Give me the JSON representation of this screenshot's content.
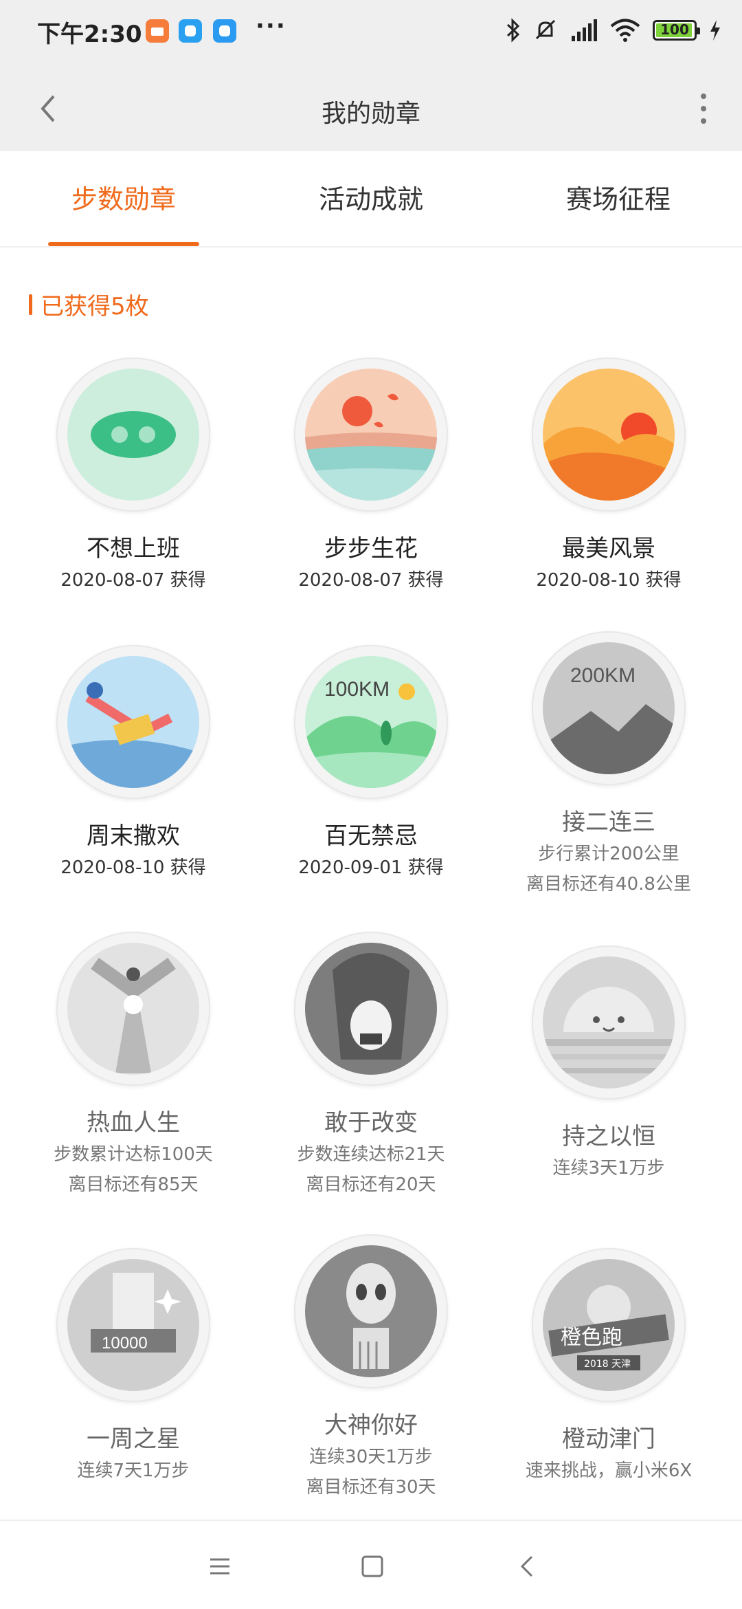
{
  "status_bar": {
    "time": "下午2:30",
    "dots": "···",
    "battery": "100",
    "icons": [
      "mi-app-icon",
      "app-icon-blue",
      "app-icon-blue-2",
      "bluetooth-icon",
      "mute-icon",
      "signal-icon",
      "wifi-icon",
      "battery-icon",
      "charging-icon"
    ]
  },
  "header": {
    "title": "我的勋章",
    "back_icon": "chevron-left-icon",
    "more_icon": "more-vertical-icon"
  },
  "tabs": [
    {
      "label": "步数勋章",
      "active": true
    },
    {
      "label": "活动成就",
      "active": false
    },
    {
      "label": "赛场征程",
      "active": false
    }
  ],
  "section": {
    "earned_label": "已获得5枚"
  },
  "badges": [
    {
      "name": "不想上班",
      "line1": "2020-08-07 获得",
      "line2": "",
      "earned": true,
      "image": "pig-nose"
    },
    {
      "name": "步步生花",
      "line1": "2020-08-07 获得",
      "line2": "",
      "earned": true,
      "image": "sunset-petals"
    },
    {
      "name": "最美风景",
      "line1": "2020-08-10 获得",
      "line2": "",
      "earned": true,
      "image": "sunrise-dunes"
    },
    {
      "name": "周末撒欢",
      "line1": "2020-08-10 获得",
      "line2": "",
      "earned": true,
      "image": "runner-flying"
    },
    {
      "name": "百无禁忌",
      "line1": "2020-09-01 获得",
      "line2": "",
      "earned": true,
      "image": "100km-hills",
      "badge_text": "100KM"
    },
    {
      "name": "接二连三",
      "line1": "步行累计200公里",
      "line2": "离目标还有40.8公里",
      "earned": false,
      "image": "200km-mountains",
      "badge_text": "200KM"
    },
    {
      "name": "热血人生",
      "line1": "步数累计达标100天",
      "line2": "离目标还有85天",
      "earned": false,
      "image": "hero-heart"
    },
    {
      "name": "敢于改变",
      "line1": "步数连续达标21天",
      "line2": "离目标还有20天",
      "earned": false,
      "image": "bald-head"
    },
    {
      "name": "持之以恒",
      "line1": "连续3天1万步",
      "line2": "",
      "earned": false,
      "image": "smiling-sun"
    },
    {
      "name": "一周之星",
      "line1": "连续7天1万步",
      "line2": "",
      "earned": false,
      "image": "10000-star",
      "badge_text": "10000"
    },
    {
      "name": "大神你好",
      "line1": "连续30天1万步",
      "line2": "离目标还有30天",
      "earned": false,
      "image": "alien-comb"
    },
    {
      "name": "橙动津门",
      "line1": "速来挑战，赢小米6X",
      "line2": "",
      "earned": false,
      "image": "orange-run-2018",
      "badge_text": "橙色跑",
      "badge_sub": "2018 天津"
    }
  ],
  "nav": {
    "icons": [
      "menu-icon",
      "home-square-icon",
      "back-triangle-icon"
    ]
  },
  "colors": {
    "accent": "#f06a1b",
    "status_bg": "#efefef",
    "battery_green": "#7ed23a"
  }
}
